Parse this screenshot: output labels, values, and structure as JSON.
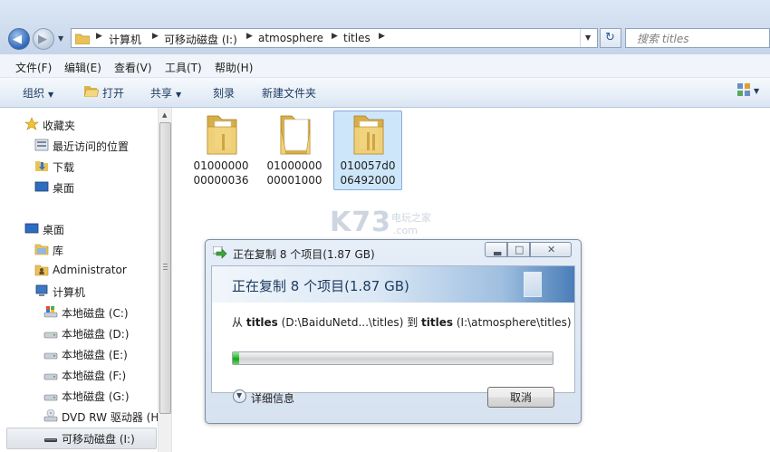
{
  "address_bar": {
    "crumbs": [
      "计算机",
      "可移动磁盘 (I:)",
      "atmosphere",
      "titles"
    ],
    "search_placeholder": "搜索 titles"
  },
  "menu": [
    "文件(F)",
    "编辑(E)",
    "查看(V)",
    "工具(T)",
    "帮助(H)"
  ],
  "toolbar": {
    "organize": "组织",
    "open": "打开",
    "share": "共享",
    "burn": "刻录",
    "new_folder": "新建文件夹"
  },
  "nav": {
    "favorites": "收藏夹",
    "recent": "最近访问的位置",
    "downloads": "下载",
    "desktop_fav": "桌面",
    "desktop": "桌面",
    "libraries": "库",
    "user": "Administrator",
    "computer": "计算机",
    "drives": [
      "本地磁盘 (C:)",
      "本地磁盘 (D:)",
      "本地磁盘 (E:)",
      "本地磁盘 (F:)",
      "本地磁盘 (G:)"
    ],
    "dvd": "DVD RW 驱动器 (H",
    "removable": "可移动磁盘 (I:)"
  },
  "folders": [
    {
      "line1": "01000000",
      "line2": "00000036"
    },
    {
      "line1": "01000000",
      "line2": "00001000"
    },
    {
      "line1": "010057d0",
      "line2": "06492000"
    }
  ],
  "watermark": {
    "big": "K73",
    "small_1": "电玩之家",
    "small_2": ".com"
  },
  "dialog": {
    "title": "正在复制 8 个项目(1.87 GB)",
    "header": "正在复制 8 个项目(1.87 GB)",
    "from_label": "从",
    "from_name": "titles",
    "from_path": "(D:\\BaiduNetd...\\titles)",
    "to_label": "到",
    "to_name": "titles",
    "to_path": "(I:\\atmosphere\\titles)",
    "progress_percent": 2,
    "details_label": "详细信息",
    "cancel_label": "取消"
  },
  "colors": {
    "progress_green": "#25b525",
    "selection_blue": "#cde6fa",
    "folder_yellow": "#f1d27a"
  }
}
